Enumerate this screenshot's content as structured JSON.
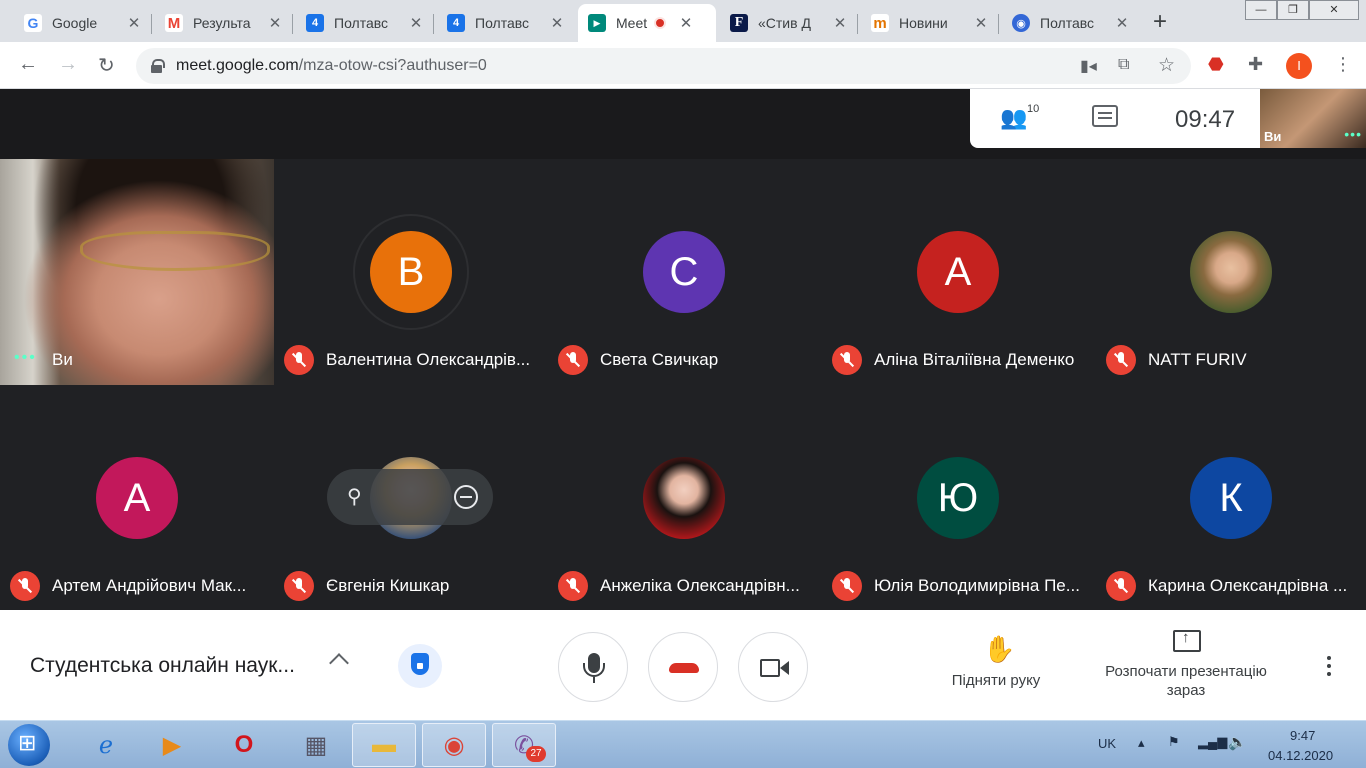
{
  "browser": {
    "tabs": [
      {
        "label": "Google",
        "favicon": "google-icon",
        "color": "#4285f4",
        "glyph": "G"
      },
      {
        "label": "Результа",
        "favicon": "gmail-icon",
        "color": "#ea4335",
        "glyph": "M"
      },
      {
        "label": "Полтавс",
        "favicon": "calendar-icon",
        "color": "#1a73e8",
        "glyph": "4"
      },
      {
        "label": "Полтавс",
        "favicon": "calendar-icon",
        "color": "#1a73e8",
        "glyph": "4"
      },
      {
        "label": "Meet",
        "favicon": "meet-icon",
        "color": "#00897b",
        "glyph": "▶"
      },
      {
        "label": "«Стив Д",
        "favicon": "forbes-icon",
        "color": "#0b1a49",
        "glyph": "F"
      },
      {
        "label": "Новини",
        "favicon": "news-icon",
        "color": "#e37400",
        "glyph": "m"
      },
      {
        "label": "Полтавс",
        "favicon": "globe-icon",
        "color": "#3367d6",
        "glyph": "◉"
      }
    ],
    "url_host": "meet.google.com",
    "url_path": "/mza-otow-csi?authuser=0",
    "profile_initial": "I"
  },
  "meet": {
    "participant_count": "10",
    "clock": "09:47",
    "self_label": "Ви",
    "tiles": [
      {
        "name": "Ви",
        "type": "video"
      },
      {
        "name": "Валентина Олександрів...",
        "initial": "В",
        "color": "#e8710a"
      },
      {
        "name": "Света Свичкар",
        "initial": "С",
        "color": "#5e35b1"
      },
      {
        "name": "Аліна Віталіївна Деменко",
        "initial": "А",
        "color": "#c5221f"
      },
      {
        "name": "NATT FURIV",
        "type": "photo1"
      },
      {
        "name": "Артем Андрійович Мак...",
        "initial": "А",
        "color": "#c2185b"
      },
      {
        "name": "Євгенія Кишкар",
        "type": "photo2"
      },
      {
        "name": "Анжеліка Олександрівн...",
        "type": "photo3"
      },
      {
        "name": "Юлія Володимирівна Пе...",
        "initial": "Ю",
        "color": "#004d40"
      },
      {
        "name": "Карина Олександрівна ...",
        "initial": "К",
        "color": "#0d47a1"
      }
    ]
  },
  "controls": {
    "meeting_title": "Студентська онлайн наук...",
    "raise_hand": "Підняти руку",
    "present_now_line1": "Розпочати презентацію",
    "present_now_line2": "зараз"
  },
  "taskbar": {
    "language": "UK",
    "time": "9:47",
    "date": "04.12.2020",
    "viber_badge": "27"
  }
}
